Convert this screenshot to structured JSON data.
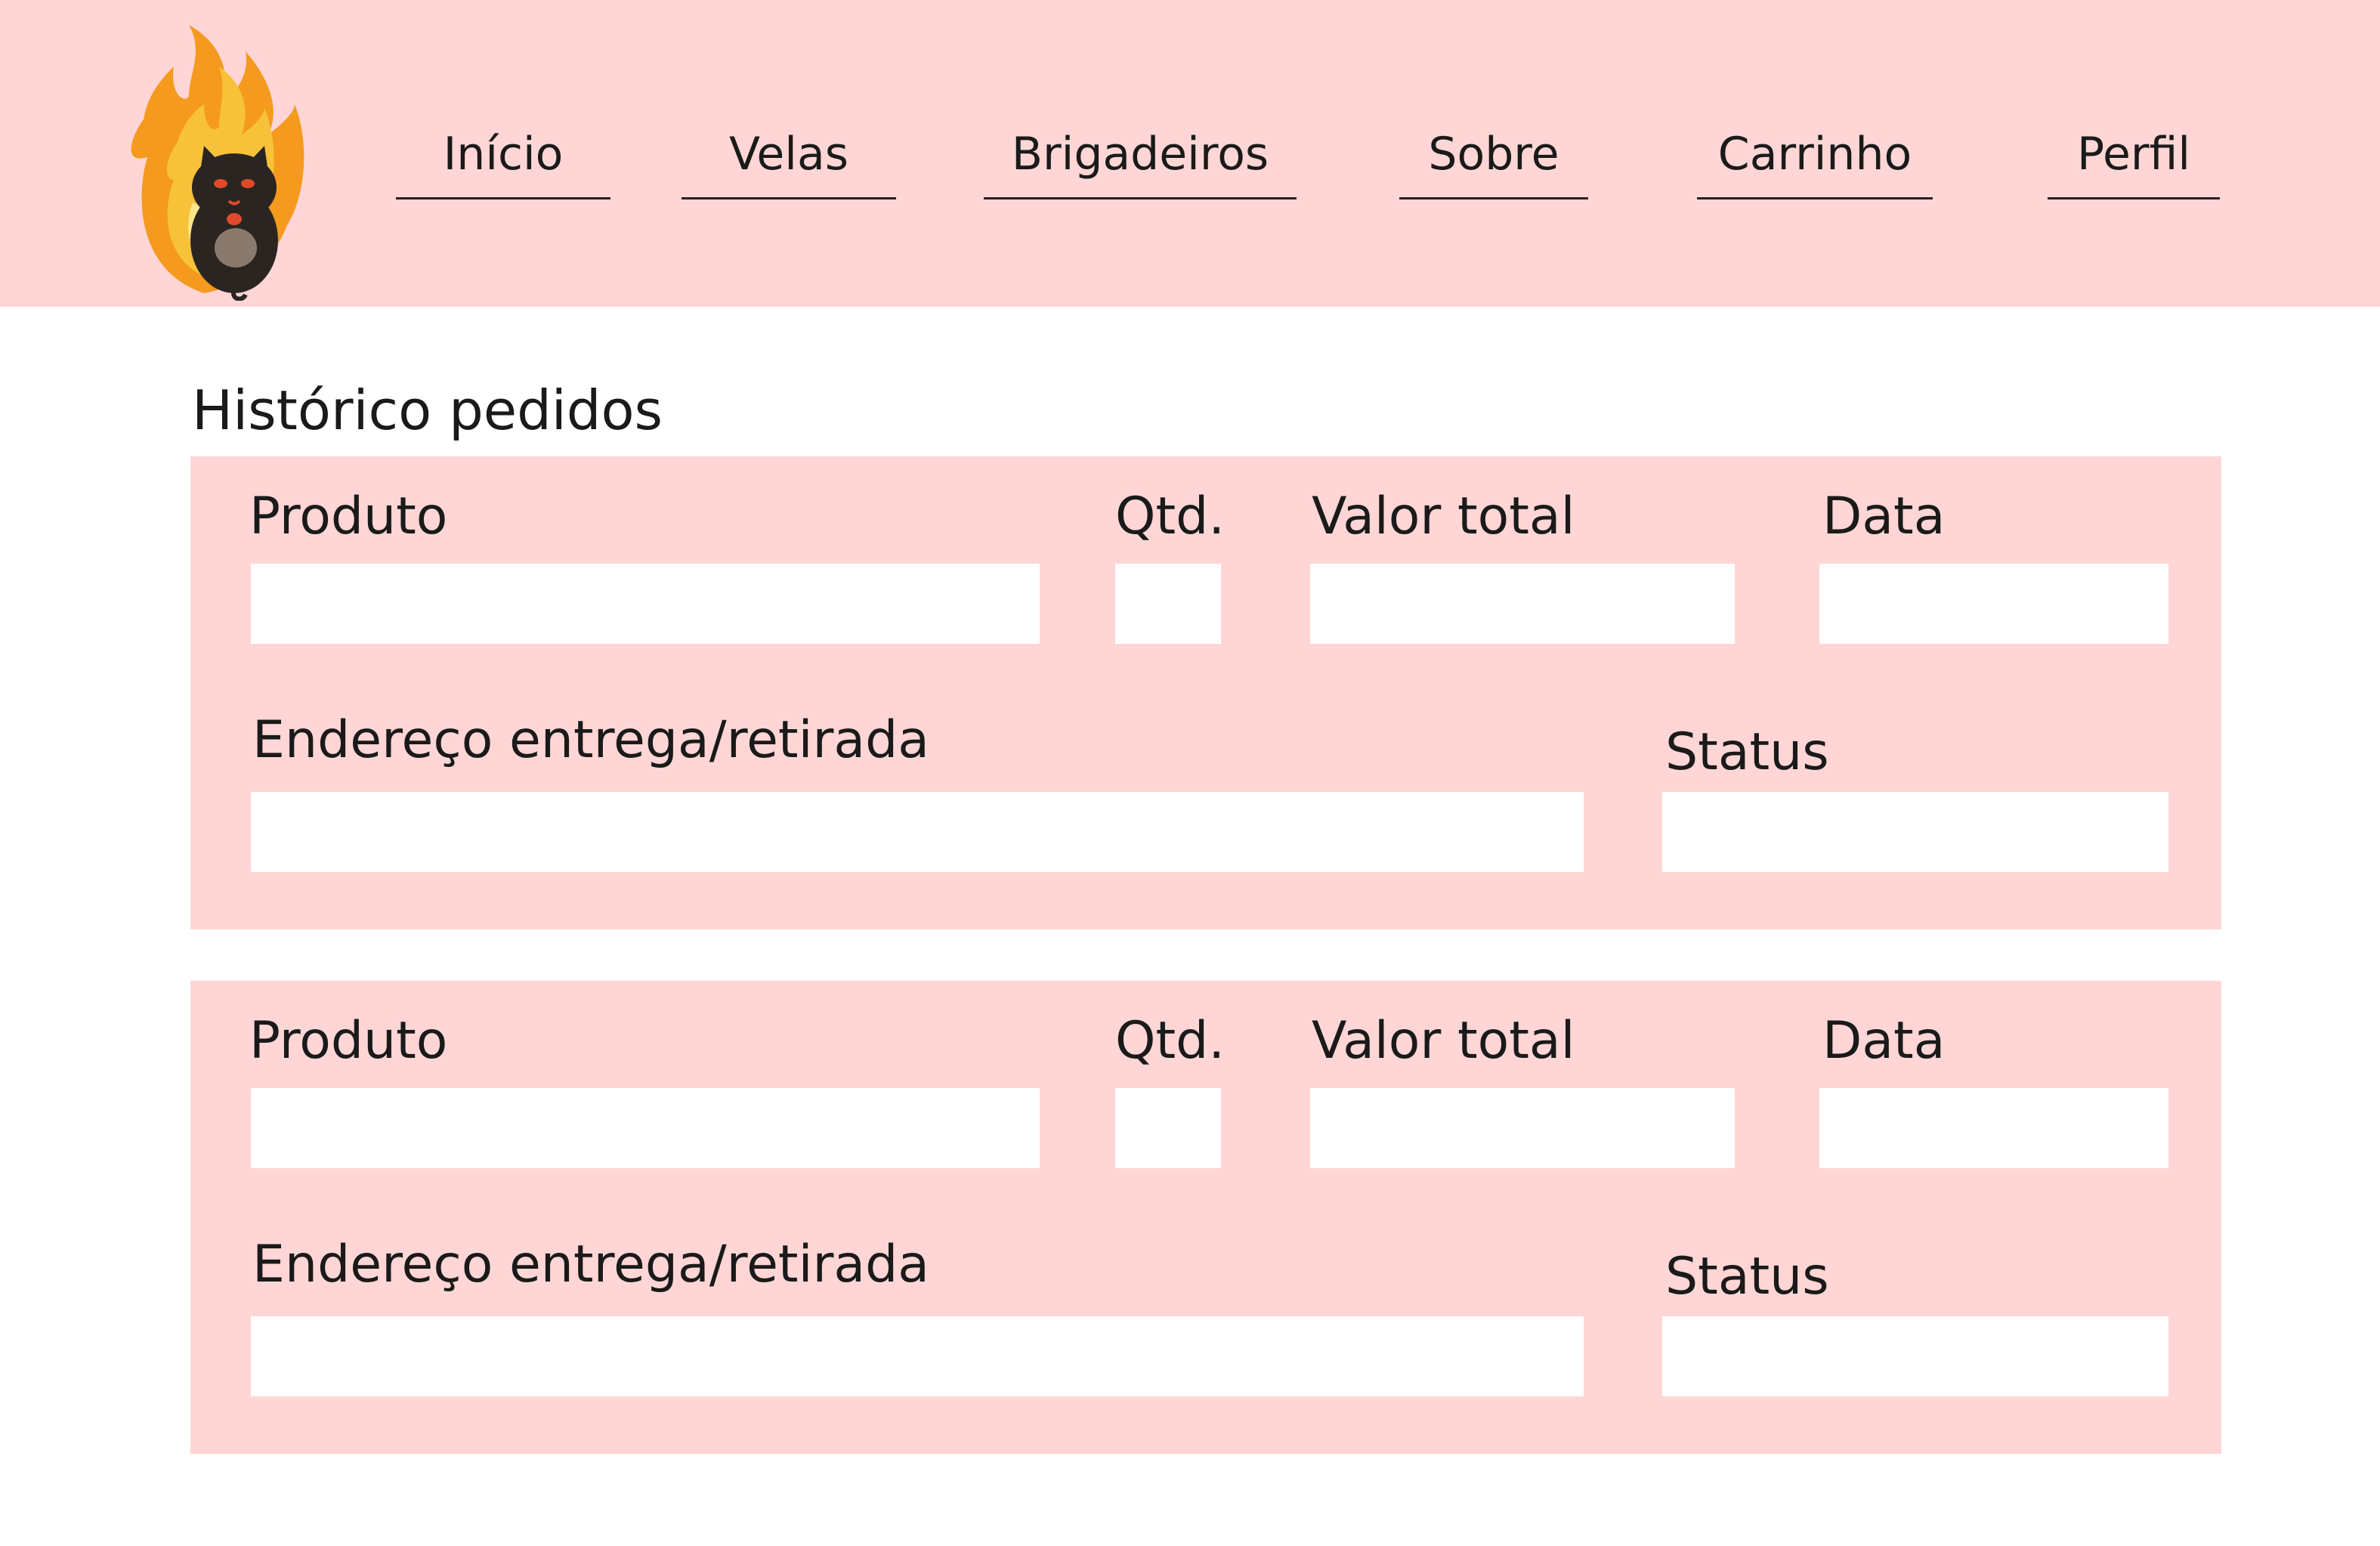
{
  "nav": {
    "items": [
      {
        "label": "Início"
      },
      {
        "label": "Velas"
      },
      {
        "label": "Brigadeiros"
      },
      {
        "label": "Sobre"
      },
      {
        "label": "Carrinho"
      },
      {
        "label": "Perfil"
      }
    ]
  },
  "page": {
    "title": "Histórico pedidos"
  },
  "orders": [
    {
      "labels": {
        "product": "Produto",
        "qty": "Qtd.",
        "total": "Valor total",
        "date": "Data",
        "address": "Endereço entrega/retirada",
        "status": "Status"
      },
      "values": {
        "product": "",
        "qty": "",
        "total": "",
        "date": "",
        "address": "",
        "status": ""
      }
    },
    {
      "labels": {
        "product": "Produto",
        "qty": "Qtd.",
        "total": "Valor total",
        "date": "Data",
        "address": "Endereço entrega/retirada",
        "status": "Status"
      },
      "values": {
        "product": "",
        "qty": "",
        "total": "",
        "date": "",
        "address": "",
        "status": ""
      }
    }
  ],
  "colors": {
    "header_bg": "#ffd6d5",
    "card_bg": "#ffd6d5",
    "field_bg": "#ffffff",
    "text": "#1a1a1a"
  },
  "icons": {
    "logo": "flame-cat-logo"
  }
}
